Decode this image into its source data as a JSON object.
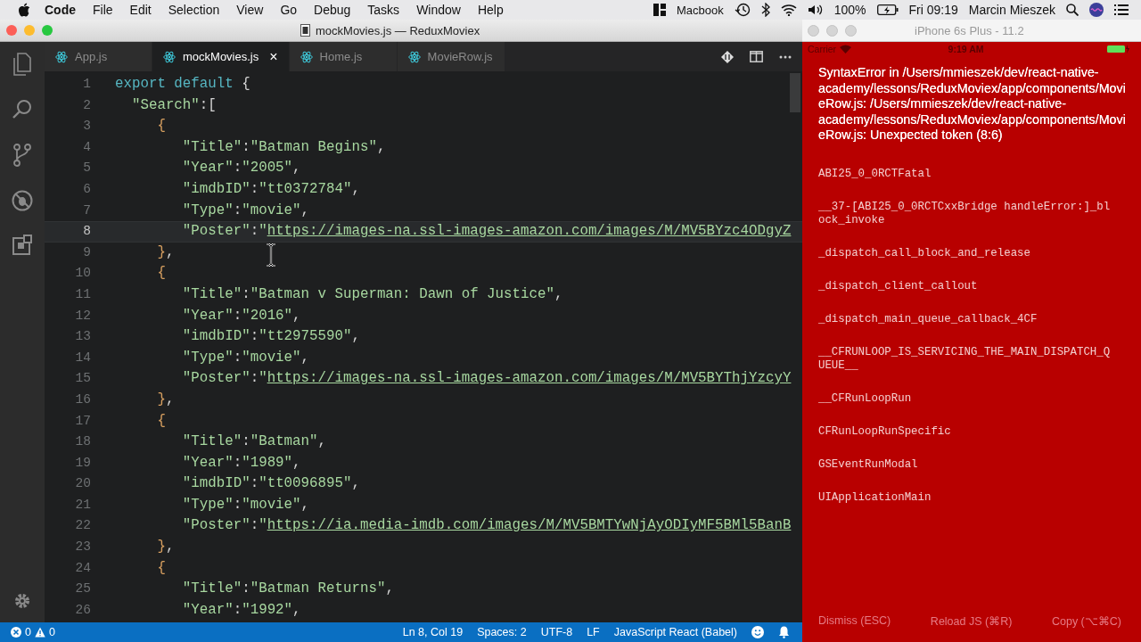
{
  "menubar": {
    "app": "Code",
    "menus": [
      "File",
      "Edit",
      "Selection",
      "View",
      "Go",
      "Debug",
      "Tasks",
      "Window",
      "Help"
    ],
    "device_label": "Macbook",
    "battery": "100%",
    "clock": "Fri 09:19",
    "user": "Marcin Mieszek"
  },
  "editor": {
    "title": "mockMovies.js — ReduxMoviex",
    "tabs": [
      {
        "label": "App.js",
        "selected": false
      },
      {
        "label": "mockMovies.js",
        "selected": true,
        "close": "×"
      },
      {
        "label": "Home.js",
        "selected": false
      },
      {
        "label": "MovieRow.js",
        "selected": false
      }
    ],
    "lines": [
      {
        "number": "1",
        "current": false,
        "segments": [
          {
            "kind": "keyword",
            "text": "export default"
          },
          {
            "kind": "punct",
            "text": " {"
          }
        ]
      },
      {
        "number": "2",
        "current": false,
        "segments": [
          {
            "kind": "key",
            "text": "  \"Search\""
          },
          {
            "kind": "punct",
            "text": ":["
          }
        ]
      },
      {
        "number": "3",
        "current": false,
        "segments": [
          {
            "kind": "brace",
            "text": "     {"
          }
        ]
      },
      {
        "number": "4",
        "current": false,
        "segments": [
          {
            "kind": "key",
            "text": "        \"Title\""
          },
          {
            "kind": "punct",
            "text": ":"
          },
          {
            "kind": "string",
            "text": "\"Batman Begins\""
          },
          {
            "kind": "punct",
            "text": ","
          }
        ]
      },
      {
        "number": "5",
        "current": false,
        "segments": [
          {
            "kind": "key",
            "text": "        \"Year\""
          },
          {
            "kind": "punct",
            "text": ":"
          },
          {
            "kind": "string",
            "text": "\"2005\""
          },
          {
            "kind": "punct",
            "text": ","
          }
        ]
      },
      {
        "number": "6",
        "current": false,
        "segments": [
          {
            "kind": "key",
            "text": "        \"imdbID\""
          },
          {
            "kind": "punct",
            "text": ":"
          },
          {
            "kind": "string",
            "text": "\"tt0372784\""
          },
          {
            "kind": "punct",
            "text": ","
          }
        ]
      },
      {
        "number": "7",
        "current": false,
        "segments": [
          {
            "kind": "key",
            "text": "        \"Type\""
          },
          {
            "kind": "punct",
            "text": ":"
          },
          {
            "kind": "string",
            "text": "\"movie\""
          },
          {
            "kind": "punct",
            "text": ","
          }
        ]
      },
      {
        "number": "8",
        "current": true,
        "segments": [
          {
            "kind": "key",
            "text": "        \"Poster\""
          },
          {
            "kind": "punct",
            "text": ":"
          },
          {
            "kind": "string",
            "text": "\""
          },
          {
            "kind": "link",
            "text": "https://images-na.ssl-images-amazon.com/images/M/MV5BYzc4ODgyZ"
          }
        ]
      },
      {
        "number": "9",
        "current": false,
        "segments": [
          {
            "kind": "brace",
            "text": "     }"
          },
          {
            "kind": "punct",
            "text": ","
          }
        ]
      },
      {
        "number": "10",
        "current": false,
        "segments": [
          {
            "kind": "brace",
            "text": "     {"
          }
        ]
      },
      {
        "number": "11",
        "current": false,
        "segments": [
          {
            "kind": "key",
            "text": "        \"Title\""
          },
          {
            "kind": "punct",
            "text": ":"
          },
          {
            "kind": "string",
            "text": "\"Batman v Superman: Dawn of Justice\""
          },
          {
            "kind": "punct",
            "text": ","
          }
        ]
      },
      {
        "number": "12",
        "current": false,
        "segments": [
          {
            "kind": "key",
            "text": "        \"Year\""
          },
          {
            "kind": "punct",
            "text": ":"
          },
          {
            "kind": "string",
            "text": "\"2016\""
          },
          {
            "kind": "punct",
            "text": ","
          }
        ]
      },
      {
        "number": "13",
        "current": false,
        "segments": [
          {
            "kind": "key",
            "text": "        \"imdbID\""
          },
          {
            "kind": "punct",
            "text": ":"
          },
          {
            "kind": "string",
            "text": "\"tt2975590\""
          },
          {
            "kind": "punct",
            "text": ","
          }
        ]
      },
      {
        "number": "14",
        "current": false,
        "segments": [
          {
            "kind": "key",
            "text": "        \"Type\""
          },
          {
            "kind": "punct",
            "text": ":"
          },
          {
            "kind": "string",
            "text": "\"movie\""
          },
          {
            "kind": "punct",
            "text": ","
          }
        ]
      },
      {
        "number": "15",
        "current": false,
        "segments": [
          {
            "kind": "key",
            "text": "        \"Poster\""
          },
          {
            "kind": "punct",
            "text": ":"
          },
          {
            "kind": "string",
            "text": "\""
          },
          {
            "kind": "link",
            "text": "https://images-na.ssl-images-amazon.com/images/M/MV5BYThjYzcyY"
          }
        ]
      },
      {
        "number": "16",
        "current": false,
        "segments": [
          {
            "kind": "brace",
            "text": "     }"
          },
          {
            "kind": "punct",
            "text": ","
          }
        ]
      },
      {
        "number": "17",
        "current": false,
        "segments": [
          {
            "kind": "brace",
            "text": "     {"
          }
        ]
      },
      {
        "number": "18",
        "current": false,
        "segments": [
          {
            "kind": "key",
            "text": "        \"Title\""
          },
          {
            "kind": "punct",
            "text": ":"
          },
          {
            "kind": "string",
            "text": "\"Batman\""
          },
          {
            "kind": "punct",
            "text": ","
          }
        ]
      },
      {
        "number": "19",
        "current": false,
        "segments": [
          {
            "kind": "key",
            "text": "        \"Year\""
          },
          {
            "kind": "punct",
            "text": ":"
          },
          {
            "kind": "string",
            "text": "\"1989\""
          },
          {
            "kind": "punct",
            "text": ","
          }
        ]
      },
      {
        "number": "20",
        "current": false,
        "segments": [
          {
            "kind": "key",
            "text": "        \"imdbID\""
          },
          {
            "kind": "punct",
            "text": ":"
          },
          {
            "kind": "string",
            "text": "\"tt0096895\""
          },
          {
            "kind": "punct",
            "text": ","
          }
        ]
      },
      {
        "number": "21",
        "current": false,
        "segments": [
          {
            "kind": "key",
            "text": "        \"Type\""
          },
          {
            "kind": "punct",
            "text": ":"
          },
          {
            "kind": "string",
            "text": "\"movie\""
          },
          {
            "kind": "punct",
            "text": ","
          }
        ]
      },
      {
        "number": "22",
        "current": false,
        "segments": [
          {
            "kind": "key",
            "text": "        \"Poster\""
          },
          {
            "kind": "punct",
            "text": ":"
          },
          {
            "kind": "string",
            "text": "\""
          },
          {
            "kind": "link",
            "text": "https://ia.media-imdb.com/images/M/MV5BMTYwNjAyODIyMF5BMl5BanB"
          }
        ]
      },
      {
        "number": "23",
        "current": false,
        "segments": [
          {
            "kind": "brace",
            "text": "     }"
          },
          {
            "kind": "punct",
            "text": ","
          }
        ]
      },
      {
        "number": "24",
        "current": false,
        "segments": [
          {
            "kind": "brace",
            "text": "     {"
          }
        ]
      },
      {
        "number": "25",
        "current": false,
        "segments": [
          {
            "kind": "key",
            "text": "        \"Title\""
          },
          {
            "kind": "punct",
            "text": ":"
          },
          {
            "kind": "string",
            "text": "\"Batman Returns\""
          },
          {
            "kind": "punct",
            "text": ","
          }
        ]
      },
      {
        "number": "26",
        "current": false,
        "segments": [
          {
            "kind": "key",
            "text": "        \"Year\""
          },
          {
            "kind": "punct",
            "text": ":"
          },
          {
            "kind": "string",
            "text": "\"1992\""
          },
          {
            "kind": "punct",
            "text": ","
          }
        ]
      }
    ],
    "status_bar": {
      "errors": "0",
      "warnings": "0",
      "items": [
        "Ln 8, Col 19",
        "Spaces: 2",
        "UTF-8",
        "LF",
        "JavaScript React (Babel)"
      ]
    }
  },
  "simulator": {
    "title": "iPhone 6s Plus - 11.2",
    "carrier": "Carrier",
    "time": "9:19 AM",
    "error_message": "SyntaxError in /Users/mmieszek/dev/react-native-academy/lessons/ReduxMoviex/app/components/MovieRow.js: /Users/mmieszek/dev/react-native-academy/lessons/ReduxMoviex/app/components/MovieRow.js: Unexpected token (8:6)",
    "stack": [
      "ABI25_0_0RCTFatal",
      "__37-[ABI25_0_0RCTCxxBridge handleError:]_block_invoke",
      "_dispatch_call_block_and_release",
      "_dispatch_client_callout",
      "_dispatch_main_queue_callback_4CF",
      "__CFRUNLOOP_IS_SERVICING_THE_MAIN_DISPATCH_QUEUE__",
      "__CFRunLoopRun",
      "CFRunLoopRunSpecific",
      "GSEventRunModal",
      "UIApplicationMain"
    ],
    "actions": [
      "Dismiss (ESC)",
      "Reload JS (⌘R)",
      "Copy (⌥⌘C)"
    ]
  }
}
